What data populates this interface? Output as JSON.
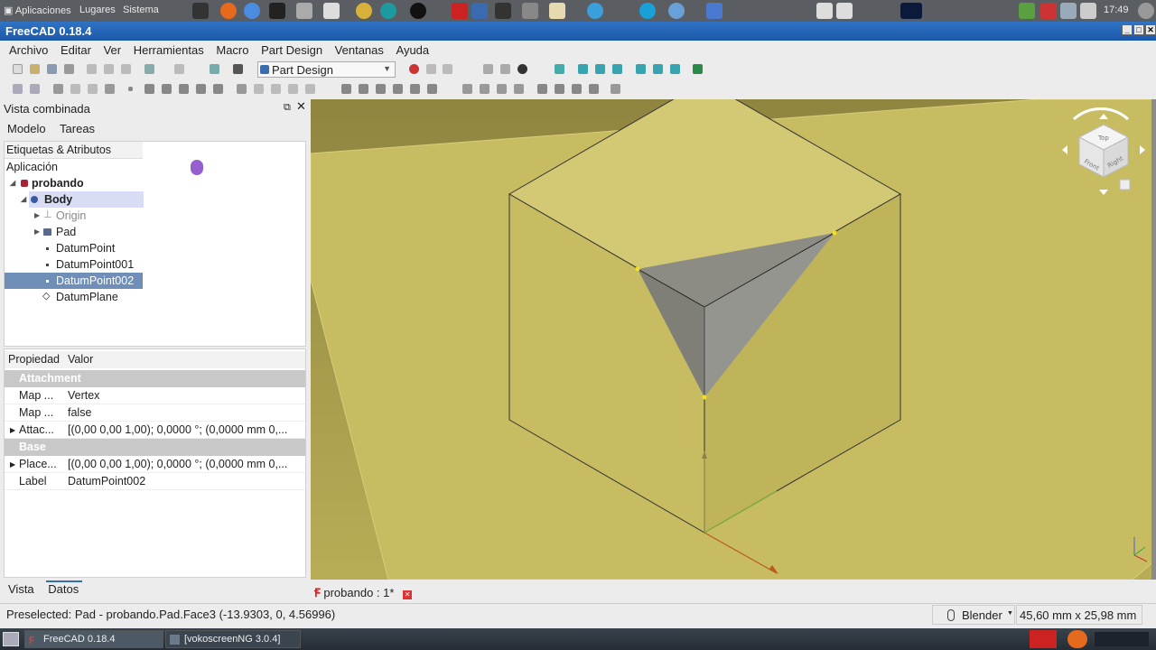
{
  "top_panel": {
    "menus": [
      "Aplicaciones",
      "Lugares",
      "Sistema"
    ],
    "clock": "17:49"
  },
  "window": {
    "title": "FreeCAD 0.18.4"
  },
  "menubar": [
    "Archivo",
    "Editar",
    "Ver",
    "Herramientas",
    "Macro",
    "Part Design",
    "Ventanas",
    "Ayuda"
  ],
  "toolbar": {
    "workbench": "Part Design"
  },
  "combo_view": {
    "title": "Vista combinada",
    "tabs": [
      "Modelo",
      "Tareas"
    ],
    "tree_header": "Etiquetas & Atributos",
    "tree": {
      "app": "Aplicación",
      "doc": "probando",
      "body": "Body",
      "origin": "Origin",
      "pad": "Pad",
      "dp0": "DatumPoint",
      "dp1": "DatumPoint001",
      "dp2": "DatumPoint002",
      "plane": "DatumPlane"
    },
    "props": {
      "header_prop": "Propiedad",
      "header_val": "Valor",
      "group1": "Attachment",
      "r1n": "Map ...",
      "r1v": "Vertex",
      "r2n": "Map ...",
      "r2v": "false",
      "r3n": "Attac...",
      "r3v": "[(0,00 0,00 1,00); 0,0000 °; (0,0000 mm  0,...",
      "group2": "Base",
      "r4n": "Place...",
      "r4v": "[(0,00 0,00 1,00); 0,0000 °; (0,0000 mm  0,...",
      "r5n": "Label",
      "r5v": "DatumPoint002"
    },
    "bottom_tabs": [
      "Vista",
      "Datos"
    ]
  },
  "doc_tab": "probando : 1*",
  "status": {
    "message": "Preselected: Pad - probando.Pad.Face3 (-13.9303, 0, 4.56996)",
    "nav_style": "Blender",
    "dims": "45,60 mm x 25,98 mm"
  },
  "navcube": {
    "top": "Top",
    "front": "Front",
    "right": "Right"
  },
  "taskbar": {
    "items": [
      "FreeCAD 0.18.4",
      "[vokoscreenNG 3.0.4]"
    ]
  },
  "colors": {
    "viewport_bg": "#a89e48",
    "face_light": "#cfc46e",
    "face_dark": "#b8ad56",
    "cut_face": "#8e8e86",
    "selection": "#6f8fb8",
    "title_bar": "#2467b8"
  }
}
